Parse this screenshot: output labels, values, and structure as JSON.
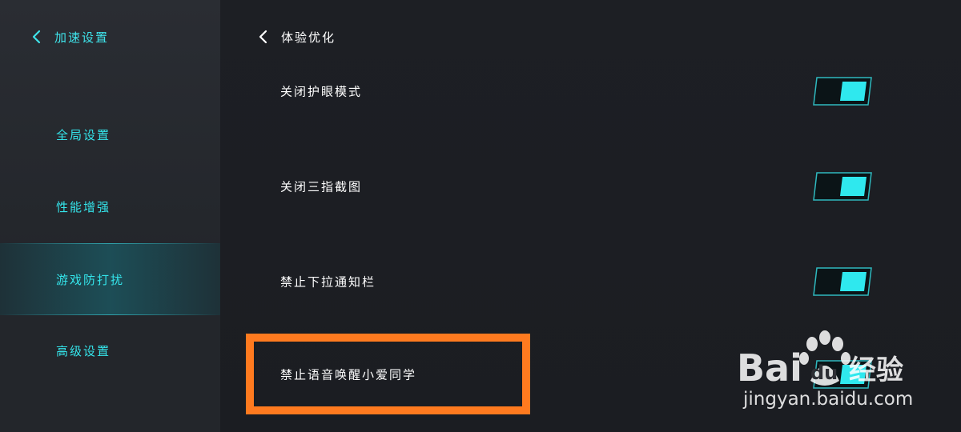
{
  "sidebar": {
    "header": {
      "label": "加速设置",
      "icon": "chevron-left-icon"
    },
    "items": [
      {
        "label": "全局设置",
        "active": false
      },
      {
        "label": "性能增强",
        "active": false
      },
      {
        "label": "游戏防打扰",
        "active": true
      },
      {
        "label": "高级设置",
        "active": false
      }
    ]
  },
  "main": {
    "header": {
      "title": "体验优化",
      "icon": "chevron-left-icon"
    },
    "settings": [
      {
        "label": "关闭护眼模式",
        "toggle": "on"
      },
      {
        "label": "关闭三指截图",
        "toggle": "on"
      },
      {
        "label": "禁止下拉通知栏",
        "toggle": "on"
      },
      {
        "label": "禁止语音唤醒小爱同学",
        "toggle": "on"
      }
    ]
  },
  "watermark": {
    "brand": "Bai du 经验",
    "url": "jingyan.baidu.com"
  },
  "colors": {
    "accent": "#34e4ea",
    "highlight": "#ff7a1f",
    "background": "#1b1d21",
    "sidebar": "#2a2d33"
  }
}
